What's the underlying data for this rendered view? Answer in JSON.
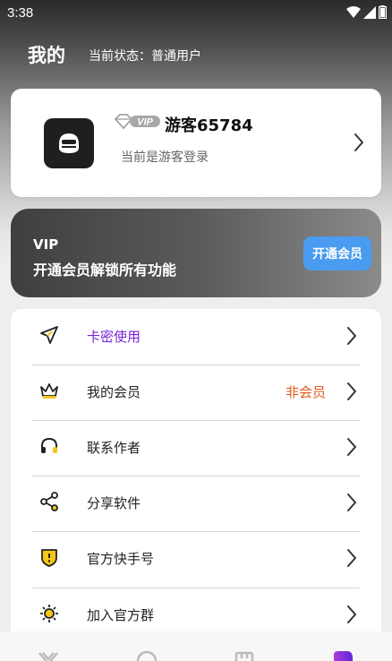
{
  "status_bar": {
    "time": "3:38"
  },
  "header": {
    "title": "我的",
    "status_line": "当前状态：普通用户"
  },
  "user_card": {
    "vip_badge": "VIP",
    "username": "游客65784",
    "login_status": "当前是游客登录"
  },
  "vip_banner": {
    "title": "VIP",
    "description": "开通会员解锁所有功能",
    "button_label": "开通会员"
  },
  "menu": {
    "items": [
      {
        "label": "卡密使用",
        "value": "",
        "icon": "paper-plane-icon",
        "label_color": "#7a22d6"
      },
      {
        "label": "我的会员",
        "value": "非会员",
        "icon": "crown-icon",
        "label_color": "#222222"
      },
      {
        "label": "联系作者",
        "value": "",
        "icon": "headphones-icon",
        "label_color": "#222222"
      },
      {
        "label": "分享软件",
        "value": "",
        "icon": "share-icon",
        "label_color": "#222222"
      },
      {
        "label": "官方快手号",
        "value": "",
        "icon": "shield-alert-icon",
        "label_color": "#222222"
      },
      {
        "label": "加入官方群",
        "value": "",
        "icon": "sun-gear-icon",
        "label_color": "#222222"
      }
    ]
  },
  "colors": {
    "accent_purple": "#7a22d6",
    "warning_orange": "#e05a1f",
    "vip_button": "#4a9cf0",
    "icon_yellow": "#f5c518"
  }
}
